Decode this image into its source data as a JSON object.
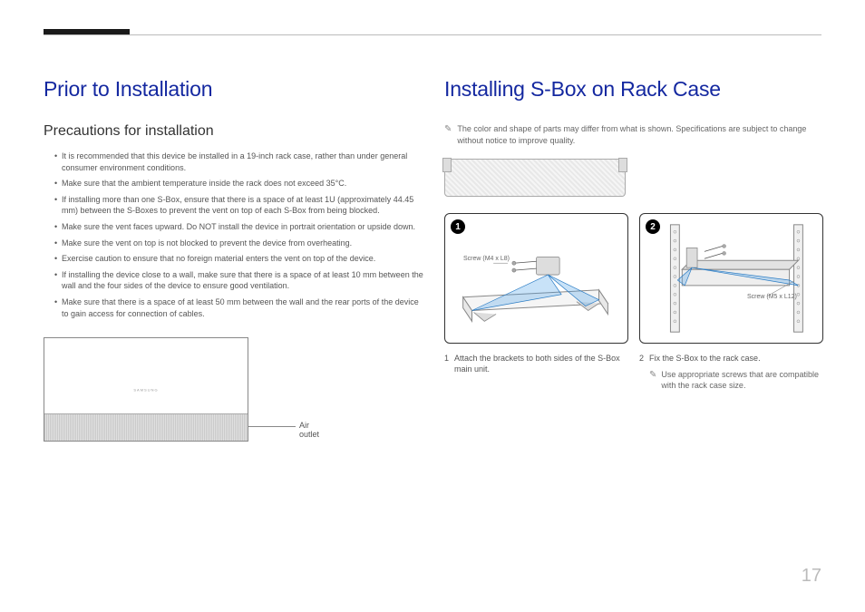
{
  "left": {
    "heading": "Prior to Installation",
    "subheading": "Precautions for installation",
    "items": [
      "It is recommended that this device be installed in a 19-inch rack case, rather than under general consumer environment conditions.",
      "Make sure that the ambient temperature inside the rack does not exceed 35°C.",
      "If installing more than one S-Box, ensure that there is a space of at least 1U (approximately 44.45 mm) between the S-Boxes to prevent the vent on top of each S-Box from being blocked.",
      "Make sure the vent faces upward. Do NOT install the device in portrait orientation or upside down.",
      "Make sure the vent on top is not blocked to prevent the device from overheating.",
      "Exercise caution to ensure that no foreign material enters the vent on top of the device.",
      "If installing the device close to a wall, make sure that there is a space of at least 10 mm between the wall and the four sides of the device to ensure good ventilation.",
      "Make sure that there is a space of at least 50 mm between the wall and the rear ports of the device to gain access for connection of cables."
    ],
    "airOutletLabel": "Air outlet",
    "deviceBrand": "SAMSUNG"
  },
  "right": {
    "heading": "Installing S-Box on Rack Case",
    "noteText": "The color and shape of parts may differ from what is shown. Specifications are subject to change without notice to improve quality.",
    "step1": {
      "screwLabel": "Screw\n(M4 x L8)",
      "num": "1",
      "caption": "Attach the brackets to both sides of the S-Box main unit."
    },
    "step2": {
      "screwLabel": "Screw\n(M5 x L12)",
      "num": "2",
      "caption": "Fix the S-Box to the rack case.",
      "subnote": "Use appropriate screws that are compatible with the rack case size."
    }
  },
  "pageNumber": "17"
}
